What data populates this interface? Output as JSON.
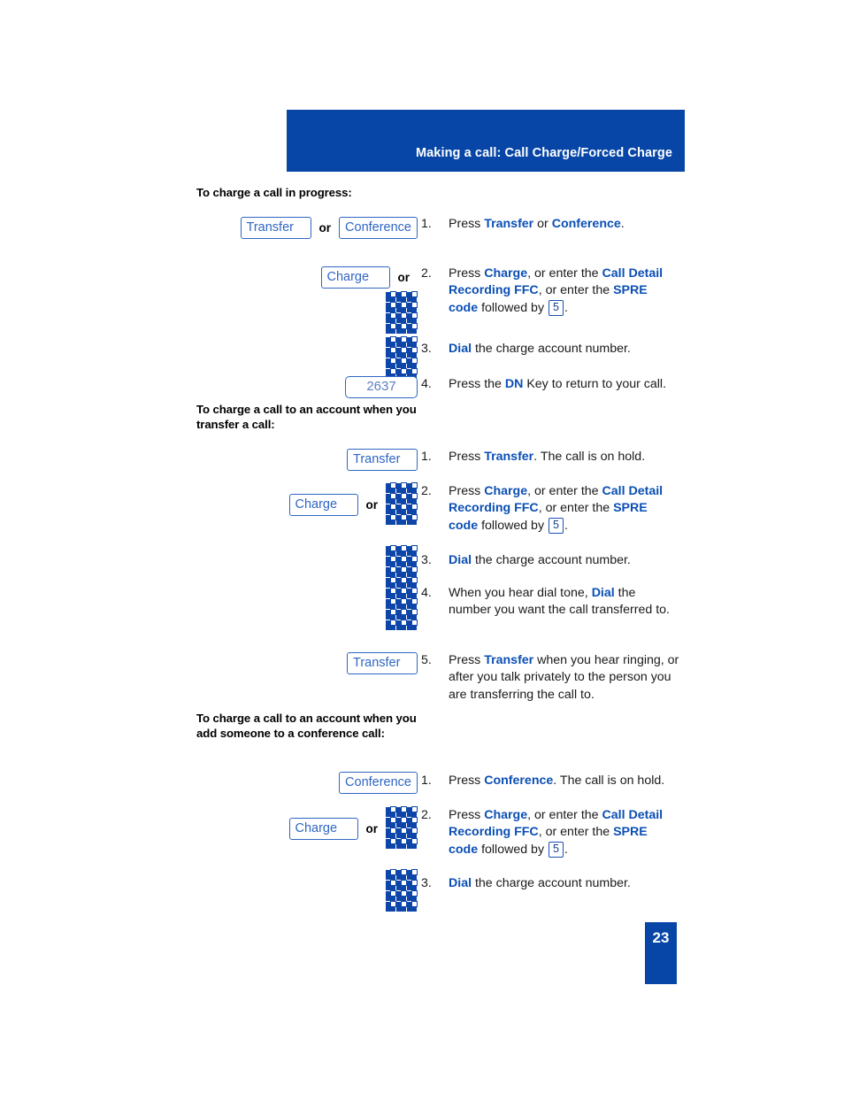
{
  "header": {
    "title": "Making a call: Call Charge/Forced Charge"
  },
  "page_number": "23",
  "sections": [
    {
      "heading": "To charge a call in progress:",
      "keys": {
        "transfer": "Transfer",
        "conference": "Conference",
        "charge": "Charge",
        "or": "or",
        "display_value": "2637"
      },
      "steps": [
        {
          "number": "1.",
          "parts": [
            {
              "t": "Press ",
              "s": "plain"
            },
            {
              "t": "Transfer",
              "s": "hl"
            },
            {
              "t": " or ",
              "s": "plain"
            },
            {
              "t": "Conference",
              "s": "hl"
            },
            {
              "t": ".",
              "s": "plain"
            }
          ]
        },
        {
          "number": "2.",
          "parts": [
            {
              "t": "Press ",
              "s": "plain"
            },
            {
              "t": "Charge",
              "s": "hl"
            },
            {
              "t": ", or enter the ",
              "s": "plain"
            },
            {
              "t": "Call Detail Recording FFC",
              "s": "hl"
            },
            {
              "t": ", or enter the ",
              "s": "plain"
            },
            {
              "t": "SPRE code",
              "s": "hl"
            },
            {
              "t": " followed by ",
              "s": "plain"
            },
            {
              "t": "5",
              "s": "key"
            },
            {
              "t": ".",
              "s": "plain"
            }
          ]
        },
        {
          "number": "3.",
          "parts": [
            {
              "t": "Dial",
              "s": "hl"
            },
            {
              "t": " the charge account number.",
              "s": "plain"
            }
          ]
        },
        {
          "number": "4.",
          "parts": [
            {
              "t": "Press the ",
              "s": "plain"
            },
            {
              "t": "DN",
              "s": "hl"
            },
            {
              "t": " Key to return to your call.",
              "s": "plain"
            }
          ]
        }
      ]
    },
    {
      "heading": "To charge a call to an account when you transfer a call:",
      "keys": {
        "transfer": "Transfer",
        "charge": "Charge",
        "or": "or"
      },
      "steps": [
        {
          "number": "1.",
          "parts": [
            {
              "t": "Press ",
              "s": "plain"
            },
            {
              "t": "Transfer",
              "s": "hl"
            },
            {
              "t": ". The call is on hold.",
              "s": "plain"
            }
          ]
        },
        {
          "number": "2.",
          "parts": [
            {
              "t": "Press ",
              "s": "plain"
            },
            {
              "t": "Charge",
              "s": "hl"
            },
            {
              "t": ", or enter the ",
              "s": "plain"
            },
            {
              "t": "Call Detail Recording FFC",
              "s": "hl"
            },
            {
              "t": ", or enter the ",
              "s": "plain"
            },
            {
              "t": "SPRE code",
              "s": "hl"
            },
            {
              "t": " followed by ",
              "s": "plain"
            },
            {
              "t": "5",
              "s": "key"
            },
            {
              "t": ".",
              "s": "plain"
            }
          ]
        },
        {
          "number": "3.",
          "parts": [
            {
              "t": "Dial",
              "s": "hl"
            },
            {
              "t": " the charge account number.",
              "s": "plain"
            }
          ]
        },
        {
          "number": "4.",
          "parts": [
            {
              "t": "When you hear dial tone, ",
              "s": "plain"
            },
            {
              "t": "Dial",
              "s": "hl"
            },
            {
              "t": " the number you want the call transferred to.",
              "s": "plain"
            }
          ]
        },
        {
          "number": "5.",
          "parts": [
            {
              "t": "Press ",
              "s": "plain"
            },
            {
              "t": "Transfer",
              "s": "hl"
            },
            {
              "t": " when you hear ringing, or after you talk privately to the person you are transferring the call to.",
              "s": "plain"
            }
          ]
        }
      ]
    },
    {
      "heading": "To charge a call to an account when you add someone to a conference call:",
      "keys": {
        "conference": "Conference",
        "charge": "Charge",
        "or": "or"
      },
      "steps": [
        {
          "number": "1.",
          "parts": [
            {
              "t": "Press ",
              "s": "plain"
            },
            {
              "t": "Conference",
              "s": "hl"
            },
            {
              "t": ". The call is on hold.",
              "s": "plain"
            }
          ]
        },
        {
          "number": "2.",
          "parts": [
            {
              "t": "Press ",
              "s": "plain"
            },
            {
              "t": "Charge",
              "s": "hl"
            },
            {
              "t": ", or enter the ",
              "s": "plain"
            },
            {
              "t": "Call Detail Recording FFC",
              "s": "hl"
            },
            {
              "t": ", or enter the ",
              "s": "plain"
            },
            {
              "t": "SPRE code",
              "s": "hl"
            },
            {
              "t": " followed by ",
              "s": "plain"
            },
            {
              "t": "5",
              "s": "key"
            },
            {
              "t": ".",
              "s": "plain"
            }
          ]
        },
        {
          "number": "3.",
          "parts": [
            {
              "t": "Dial",
              "s": "hl"
            },
            {
              "t": " the charge account number.",
              "s": "plain"
            }
          ]
        }
      ]
    }
  ],
  "icons": {
    "keypad": "dialpad-icon"
  },
  "colors": {
    "brand_blue": "#0746a6",
    "key_border_blue": "#2f66c4",
    "highlight_blue": "#0b4fb5",
    "display_text_blue": "#5c7fbe"
  }
}
